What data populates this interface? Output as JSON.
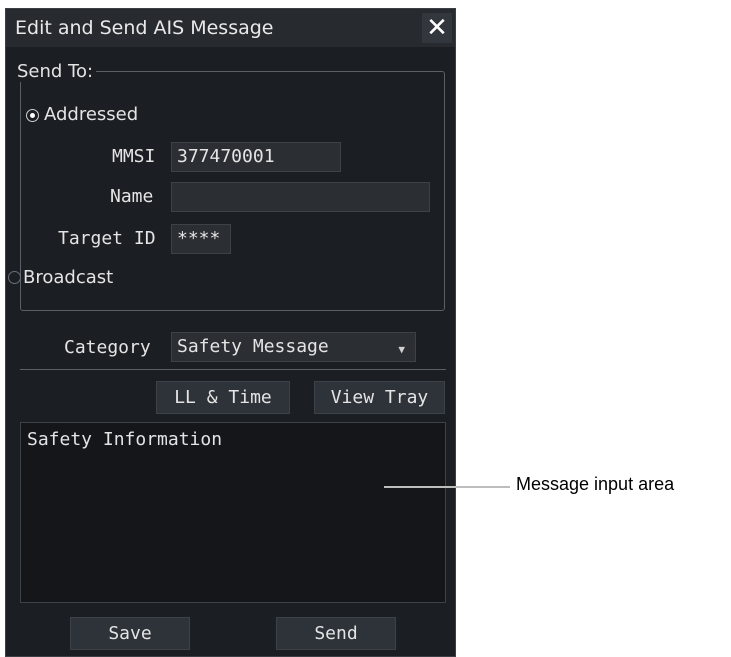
{
  "dialog": {
    "title": "Edit and Send AIS Message",
    "close_glyph": "✕"
  },
  "send_to": {
    "legend": "Send To:",
    "addressed_label": "Addressed",
    "addressed_selected": true,
    "mmsi_label": "MMSI",
    "mmsi_value": "377470001",
    "name_label": "Name",
    "name_value": "",
    "target_id_label": "Target ID",
    "target_id_value": "****",
    "broadcast_label": "Broadcast",
    "broadcast_selected": false
  },
  "category": {
    "label": "Category",
    "value": "Safety Message",
    "caret_icon": "dropdown-caret-icon"
  },
  "buttons": {
    "ll_time": "LL & Time",
    "view_tray": "View Tray",
    "save": "Save",
    "send": "Send"
  },
  "message": {
    "text": "Safety Information"
  },
  "annotation": {
    "label": "Message input area"
  },
  "colors": {
    "panel_bg": "#1b1e22",
    "field_bg": "#2b2f34",
    "text": "#e4e4e4"
  }
}
